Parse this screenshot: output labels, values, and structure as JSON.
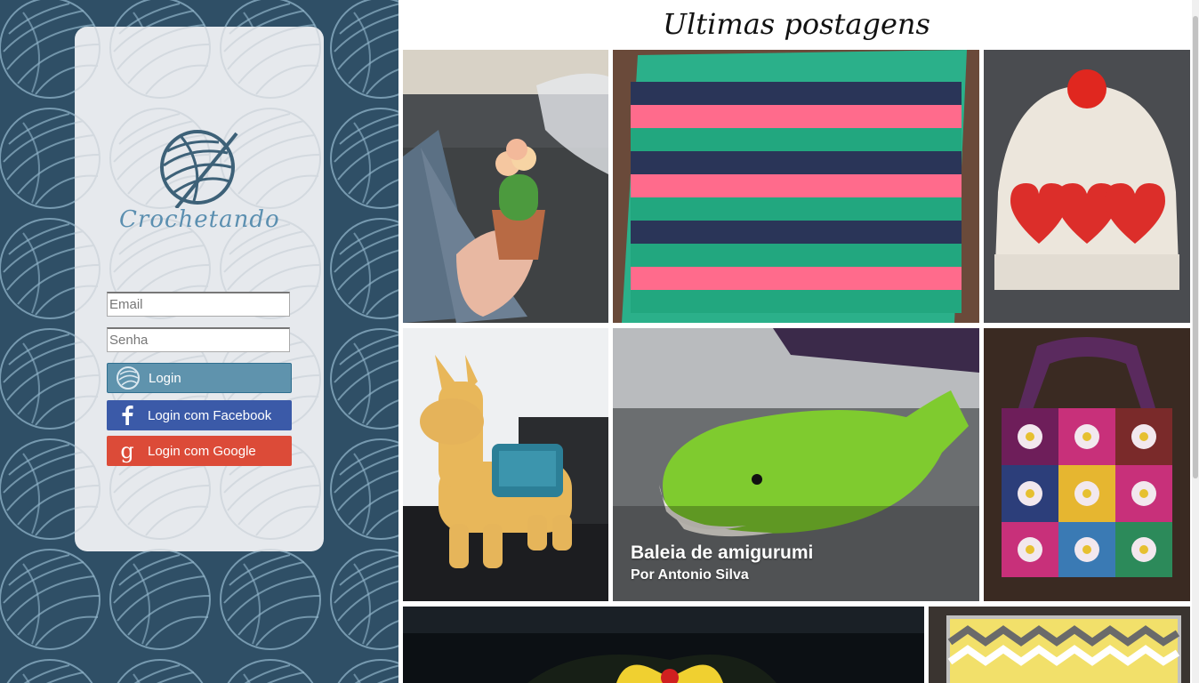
{
  "brand": {
    "name": "Crochetando"
  },
  "login": {
    "email_placeholder": "Email",
    "password_placeholder": "Senha",
    "login_label": "Login",
    "facebook_label": "Login com Facebook",
    "google_label": "Login com Google"
  },
  "feed": {
    "title": "Ultimas postagens",
    "featured": {
      "title": "Baleia de amigurumi",
      "author": "Por Antonio Silva"
    }
  },
  "colors": {
    "sidebar_bg": "#2f4f66",
    "card_bg": "#e6e9ed",
    "login_button": "#5f93ad",
    "facebook_button": "#3b5aa8",
    "google_button": "#dc4b38"
  },
  "icons": {
    "login": "yarn-ball-icon",
    "facebook": "facebook-icon",
    "google": "google-icon"
  }
}
